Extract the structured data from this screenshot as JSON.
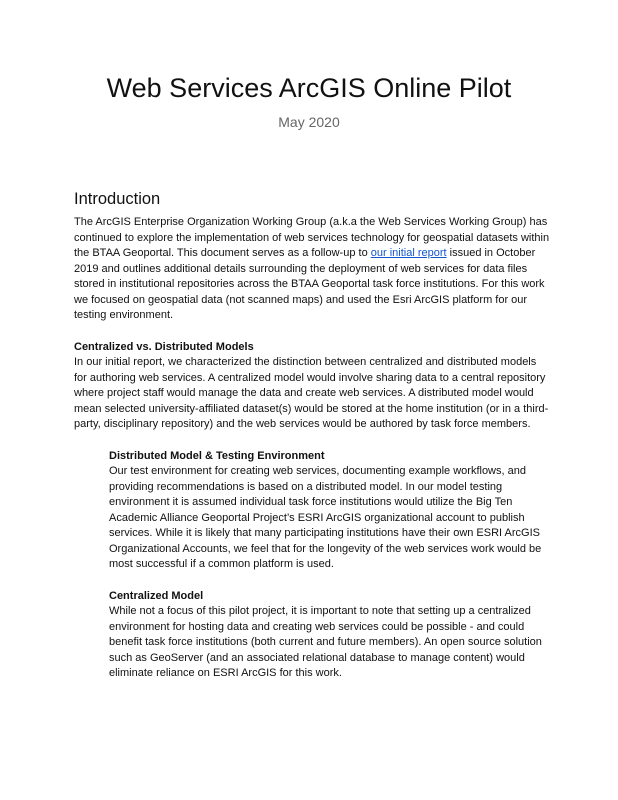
{
  "header": {
    "title": "Web Services ArcGIS Online Pilot",
    "date": "May 2020"
  },
  "intro": {
    "heading": "Introduction",
    "text_before_link": "The ArcGIS Enterprise Organization Working Group (a.k.a the Web Services Working Group) has continued to explore the implementation of web services technology for geospatial datasets within the BTAA Geoportal. This document serves as a follow-up to ",
    "link_text": "our initial report",
    "text_after_link": " issued in October 2019 and outlines additional details surrounding the deployment of web services for data files stored in institutional repositories across the BTAA Geoportal task force institutions. For this work we focused on geospatial data (not scanned maps) and used the Esri ArcGIS platform for our testing environment."
  },
  "centralized_vs_distributed": {
    "heading": "Centralized vs. Distributed Models",
    "text": "In our initial report, we characterized the distinction between centralized and distributed models for authoring web services. A centralized model would involve sharing data to a central repository where project staff would manage the data and create web services. A distributed model would mean selected university-affiliated dataset(s) would be stored at the home institution (or in a third-party, disciplinary repository) and the web services would be authored by task force members."
  },
  "distributed_model": {
    "heading": "Distributed Model & Testing Environment",
    "text": "Our test environment for creating web services, documenting example workflows, and providing recommendations is based on a distributed model. In our model testing environment it is assumed individual task force institutions would utilize the Big Ten Academic Alliance Geoportal Project’s ESRI ArcGIS organizational account to publish services. While it is likely that many participating institutions have their own ESRI ArcGIS Organizational Accounts, we feel that for the longevity of the web services work would be most successful if a common platform is used."
  },
  "centralized_model": {
    "heading": "Centralized Model",
    "text": "While not a focus of this pilot project, it is important to note that setting up a centralized environment for hosting data and creating web services could be possible - and could benefit task force institutions (both current and future members). An open source solution such as GeoServer (and an associated relational database to manage content) would eliminate reliance on ESRI ArcGIS for this work."
  },
  "colors": {
    "link": "#1155cc",
    "subtitle": "#666666",
    "text": "#111111"
  }
}
